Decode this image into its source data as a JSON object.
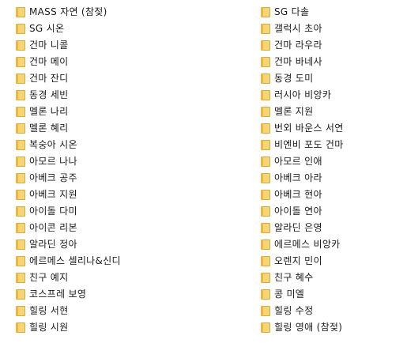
{
  "folder_icon": {
    "name": "folder-icon",
    "color": "#f5d676",
    "edge_color": "#d4ac3f"
  },
  "left_column": [
    "MASS 자연 (참젖)",
    "SG 시온",
    "건마 니콜",
    "건마 메이",
    "건마 잔디",
    "동경 세빈",
    "멜론 나리",
    "멜론 혜리",
    "복숭아 시온",
    "아모르 나나",
    "아베크 공주",
    "아베크 지원",
    "아이돌 다미",
    "아이콘 리본",
    "알라딘 정아",
    "에르메스 셀리나&신디",
    "친구 예지",
    "코스프레 보영",
    "힐링 서현",
    "힐링 시원"
  ],
  "right_column": [
    "SG 다솔",
    "갤럭시 초아",
    "건마 라우라",
    "건마 바네사",
    "동경 도미",
    "러시아 비앙카",
    "멜론 지원",
    "번외 바운스 서연",
    "비엔비 포도 건마",
    "아모르 인애",
    "아베크 아라",
    "아베크 현아",
    "아이돌 연아",
    "알라딘 은영",
    "에르메스 비앙카",
    "오렌지 민이",
    "친구 혜수",
    "콩 미엘",
    "힐링 수정",
    "힐링 영애 (참젖)"
  ]
}
